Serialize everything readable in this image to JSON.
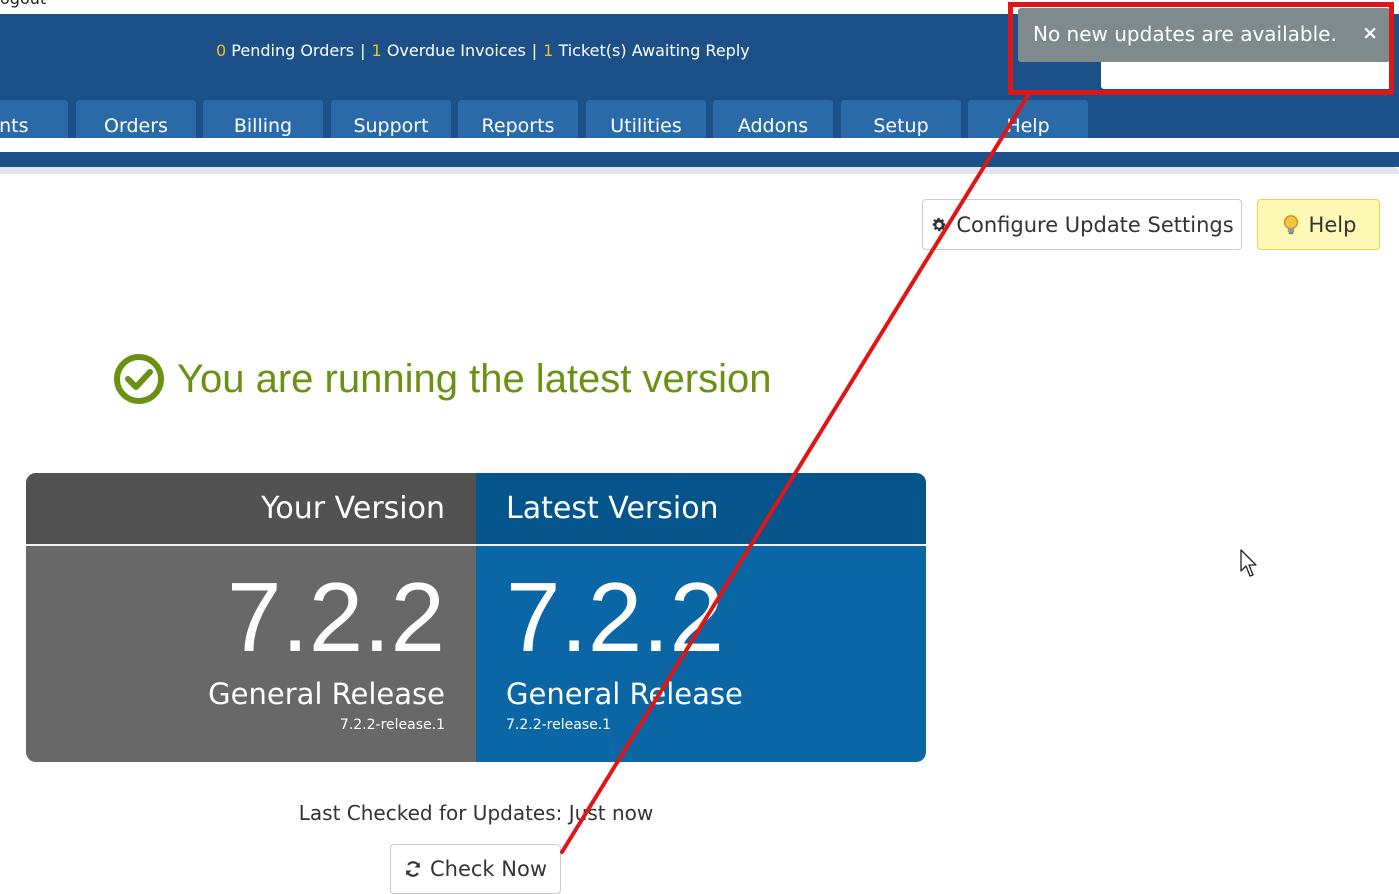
{
  "topbar": {
    "logout_label": "ogout"
  },
  "header": {
    "stats": {
      "pending_orders_count": "0",
      "pending_orders_label": "Pending Orders",
      "overdue_invoices_count": "1",
      "overdue_invoices_label": "Overdue Invoices",
      "tickets_count": "1",
      "tickets_label": "Ticket(s) Awaiting Reply",
      "separator": "|"
    }
  },
  "nav": {
    "tabs": [
      {
        "label": "ents"
      },
      {
        "label": "Orders"
      },
      {
        "label": "Billing"
      },
      {
        "label": "Support"
      },
      {
        "label": "Reports"
      },
      {
        "label": "Utilities"
      },
      {
        "label": "Addons"
      },
      {
        "label": "Setup"
      },
      {
        "label": "Help"
      }
    ]
  },
  "toolbar": {
    "configure_label": "Configure Update Settings",
    "help_label": "Help"
  },
  "status": {
    "message": "You are running the latest version"
  },
  "versions": {
    "yours": {
      "heading": "Your Version",
      "number": "7.2.2",
      "release": "General Release",
      "tag": "7.2.2-release.1"
    },
    "latest": {
      "heading": "Latest Version",
      "number": "7.2.2",
      "release": "General Release",
      "tag": "7.2.2-release.1"
    }
  },
  "last_checked": "Last Checked for Updates: Just now",
  "check_button_label": "Check Now",
  "toast": {
    "message": "No new updates are available.",
    "close_label": "×"
  },
  "colors": {
    "header_bg": "#1c5088",
    "tab_bg": "#2a6aa9",
    "status_green": "#6a9212",
    "latest_blue": "#0b66a6",
    "yours_gray": "#686868",
    "annotation_red": "#e01515",
    "stat_number_yellow": "#f0c419"
  },
  "icons": {
    "configure": "gear-icon",
    "help": "lightbulb-icon",
    "status": "check-circle-icon",
    "check_now": "refresh-icon",
    "cursor": "mouse-pointer-icon"
  }
}
